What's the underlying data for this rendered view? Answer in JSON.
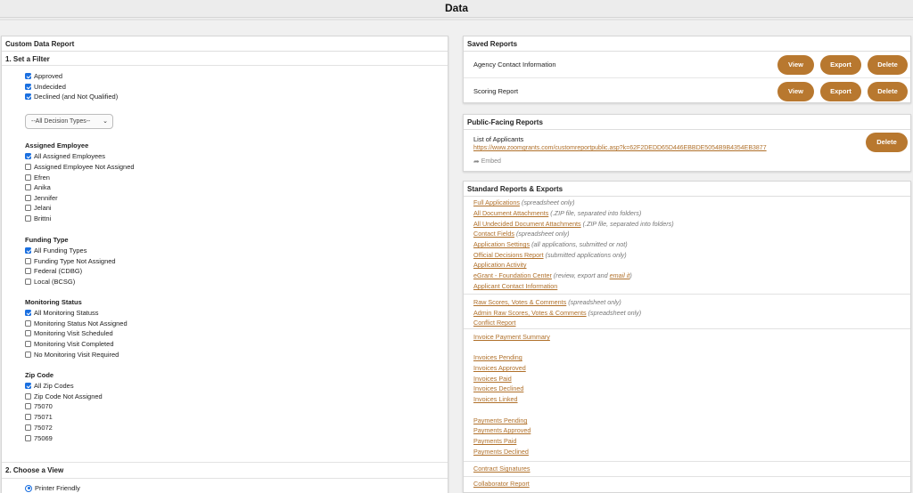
{
  "page": {
    "title": "Data"
  },
  "custom_report": {
    "title": "Custom Data Report",
    "filter_section": "1. Set a Filter",
    "statuses": [
      {
        "label": "Approved",
        "checked": true
      },
      {
        "label": "Undecided",
        "checked": true
      },
      {
        "label": "Declined (and Not Qualified)",
        "checked": true
      }
    ],
    "decision_type_select": "--All Decision Types--",
    "assigned_employee": {
      "label": "Assigned Employee",
      "options": [
        {
          "label": "All Assigned Employees",
          "checked": true
        },
        {
          "label": "Assigned Employee Not Assigned",
          "checked": false
        },
        {
          "label": "Efren",
          "checked": false
        },
        {
          "label": "Anika",
          "checked": false
        },
        {
          "label": "Jennifer",
          "checked": false
        },
        {
          "label": "Jelani",
          "checked": false
        },
        {
          "label": "Brittni",
          "checked": false
        }
      ]
    },
    "funding_type": {
      "label": "Funding Type",
      "options": [
        {
          "label": "All Funding Types",
          "checked": true
        },
        {
          "label": "Funding Type Not Assigned",
          "checked": false
        },
        {
          "label": "Federal (CDBG)",
          "checked": false
        },
        {
          "label": "Local (BCSG)",
          "checked": false
        }
      ]
    },
    "monitoring_status": {
      "label": "Monitoring Status",
      "options": [
        {
          "label": "All Monitoring Statuss",
          "checked": true
        },
        {
          "label": "Monitoring Status Not Assigned",
          "checked": false
        },
        {
          "label": "Monitoring Visit Scheduled",
          "checked": false
        },
        {
          "label": "Monitoring Visit Completed",
          "checked": false
        },
        {
          "label": "No Monitoring Visit Required",
          "checked": false
        }
      ]
    },
    "zip_code": {
      "label": "Zip Code",
      "options": [
        {
          "label": "All Zip Codes",
          "checked": true
        },
        {
          "label": "Zip Code Not Assigned",
          "checked": false
        },
        {
          "label": "75070",
          "checked": false
        },
        {
          "label": "75071",
          "checked": false
        },
        {
          "label": "75072",
          "checked": false
        },
        {
          "label": "75069",
          "checked": false
        }
      ]
    },
    "view_section": "2. Choose a View",
    "view_option": {
      "label": "Printer Friendly",
      "selected": true
    }
  },
  "saved_reports": {
    "title": "Saved Reports",
    "items": [
      {
        "name": "Agency Contact Information",
        "view": "View",
        "export": "Export",
        "delete": "Delete"
      },
      {
        "name": "Scoring Report",
        "view": "View",
        "export": "Export",
        "delete": "Delete"
      }
    ]
  },
  "public_reports": {
    "title": "Public-Facing Reports",
    "name": "List of Applicants",
    "url": "https://www.zoomgrants.com/customreportpublic.asp?k=62F2DEDD65D446EBBDE5054B9B4354EB3877",
    "embed": "Embed",
    "delete": "Delete"
  },
  "standard_reports": {
    "title": "Standard Reports & Exports",
    "group1": [
      {
        "link": "Full Applications",
        "note": "(spreadsheet only)"
      },
      {
        "link": "All Document Attachments",
        "note": "(.ZIP file, separated into folders)"
      },
      {
        "link": "All Undecided Document Attachments",
        "note": "(.ZIP file, separated into folders)"
      },
      {
        "link": "Contact Fields",
        "note": "(spreadsheet only)"
      },
      {
        "link": "Application Settings",
        "note": "(all applications, submitted or not)"
      },
      {
        "link": "Official Decisions Report",
        "note": "(submitted applications only)"
      },
      {
        "link": "Application Activity",
        "note": ""
      },
      {
        "link": "eGrant - Foundation Center",
        "note": "(review, export and",
        "extra_link": "email it",
        "tail": ")"
      },
      {
        "link": "Applicant Contact Information",
        "note": ""
      }
    ],
    "group2": [
      {
        "link": "Raw Scores, Votes & Comments",
        "note": "(spreadsheet only)"
      },
      {
        "link": "Admin Raw Scores, Votes & Comments",
        "note": "(spreadsheet only)"
      },
      {
        "link": "Conflict Report",
        "note": ""
      }
    ],
    "group3": [
      {
        "link": "Invoice Payment Summary"
      },
      {
        "link": "Invoices Pending"
      },
      {
        "link": "Invoices Approved"
      },
      {
        "link": "Invoices Paid"
      },
      {
        "link": "Invoices Declined"
      },
      {
        "link": "Invoices Linked"
      },
      {
        "link": "Payments Pending"
      },
      {
        "link": "Payments Approved"
      },
      {
        "link": "Payments Paid"
      },
      {
        "link": "Payments Declined"
      }
    ],
    "group4": [
      {
        "link": "Contract Signatures"
      }
    ],
    "group5": [
      {
        "link": "Collaborator Report"
      }
    ]
  }
}
